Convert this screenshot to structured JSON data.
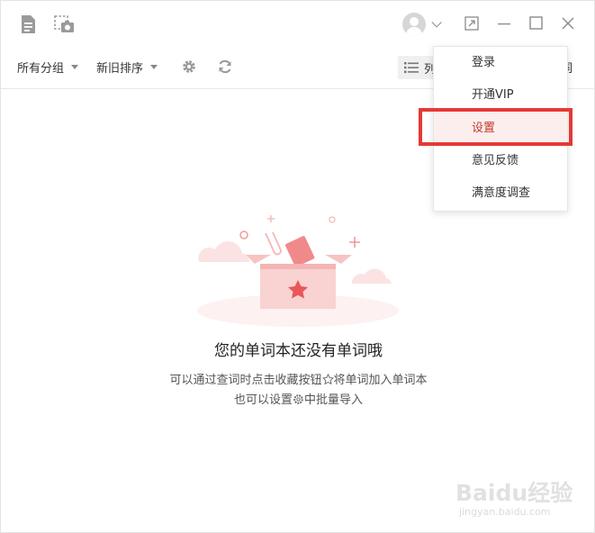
{
  "toolbar": {
    "group_filter": "所有分组",
    "sort_filter": "新旧排序",
    "list_view_label": "列",
    "right_partial_label": "词"
  },
  "menu": {
    "items": [
      {
        "label": "登录"
      },
      {
        "label": "开通VIP"
      },
      {
        "label": "设置"
      },
      {
        "label": "意见反馈"
      },
      {
        "label": "满意度调查"
      }
    ]
  },
  "empty_state": {
    "title": "您的单词本还没有单词哦",
    "line1_prefix": "可以通过查词时点击收藏按钮",
    "line1_suffix": "将单词加入单词本",
    "line2_prefix": "也可以设置",
    "line2_suffix": "中批量导入"
  },
  "watermark": {
    "logo": "Baidu经验",
    "sub": "jingyan.baidu.com"
  },
  "colors": {
    "accent": "#e53935",
    "menu_highlight_bg": "#fdeeee",
    "illustration_pink": "#f5a0a0"
  },
  "icons": [
    "document-icon",
    "camera-icon",
    "avatar-icon",
    "chevron-down-icon",
    "restore-icon",
    "minimize-icon",
    "maximize-icon",
    "close-icon",
    "gear-icon",
    "refresh-icon",
    "list-icon",
    "star-outline-icon"
  ]
}
